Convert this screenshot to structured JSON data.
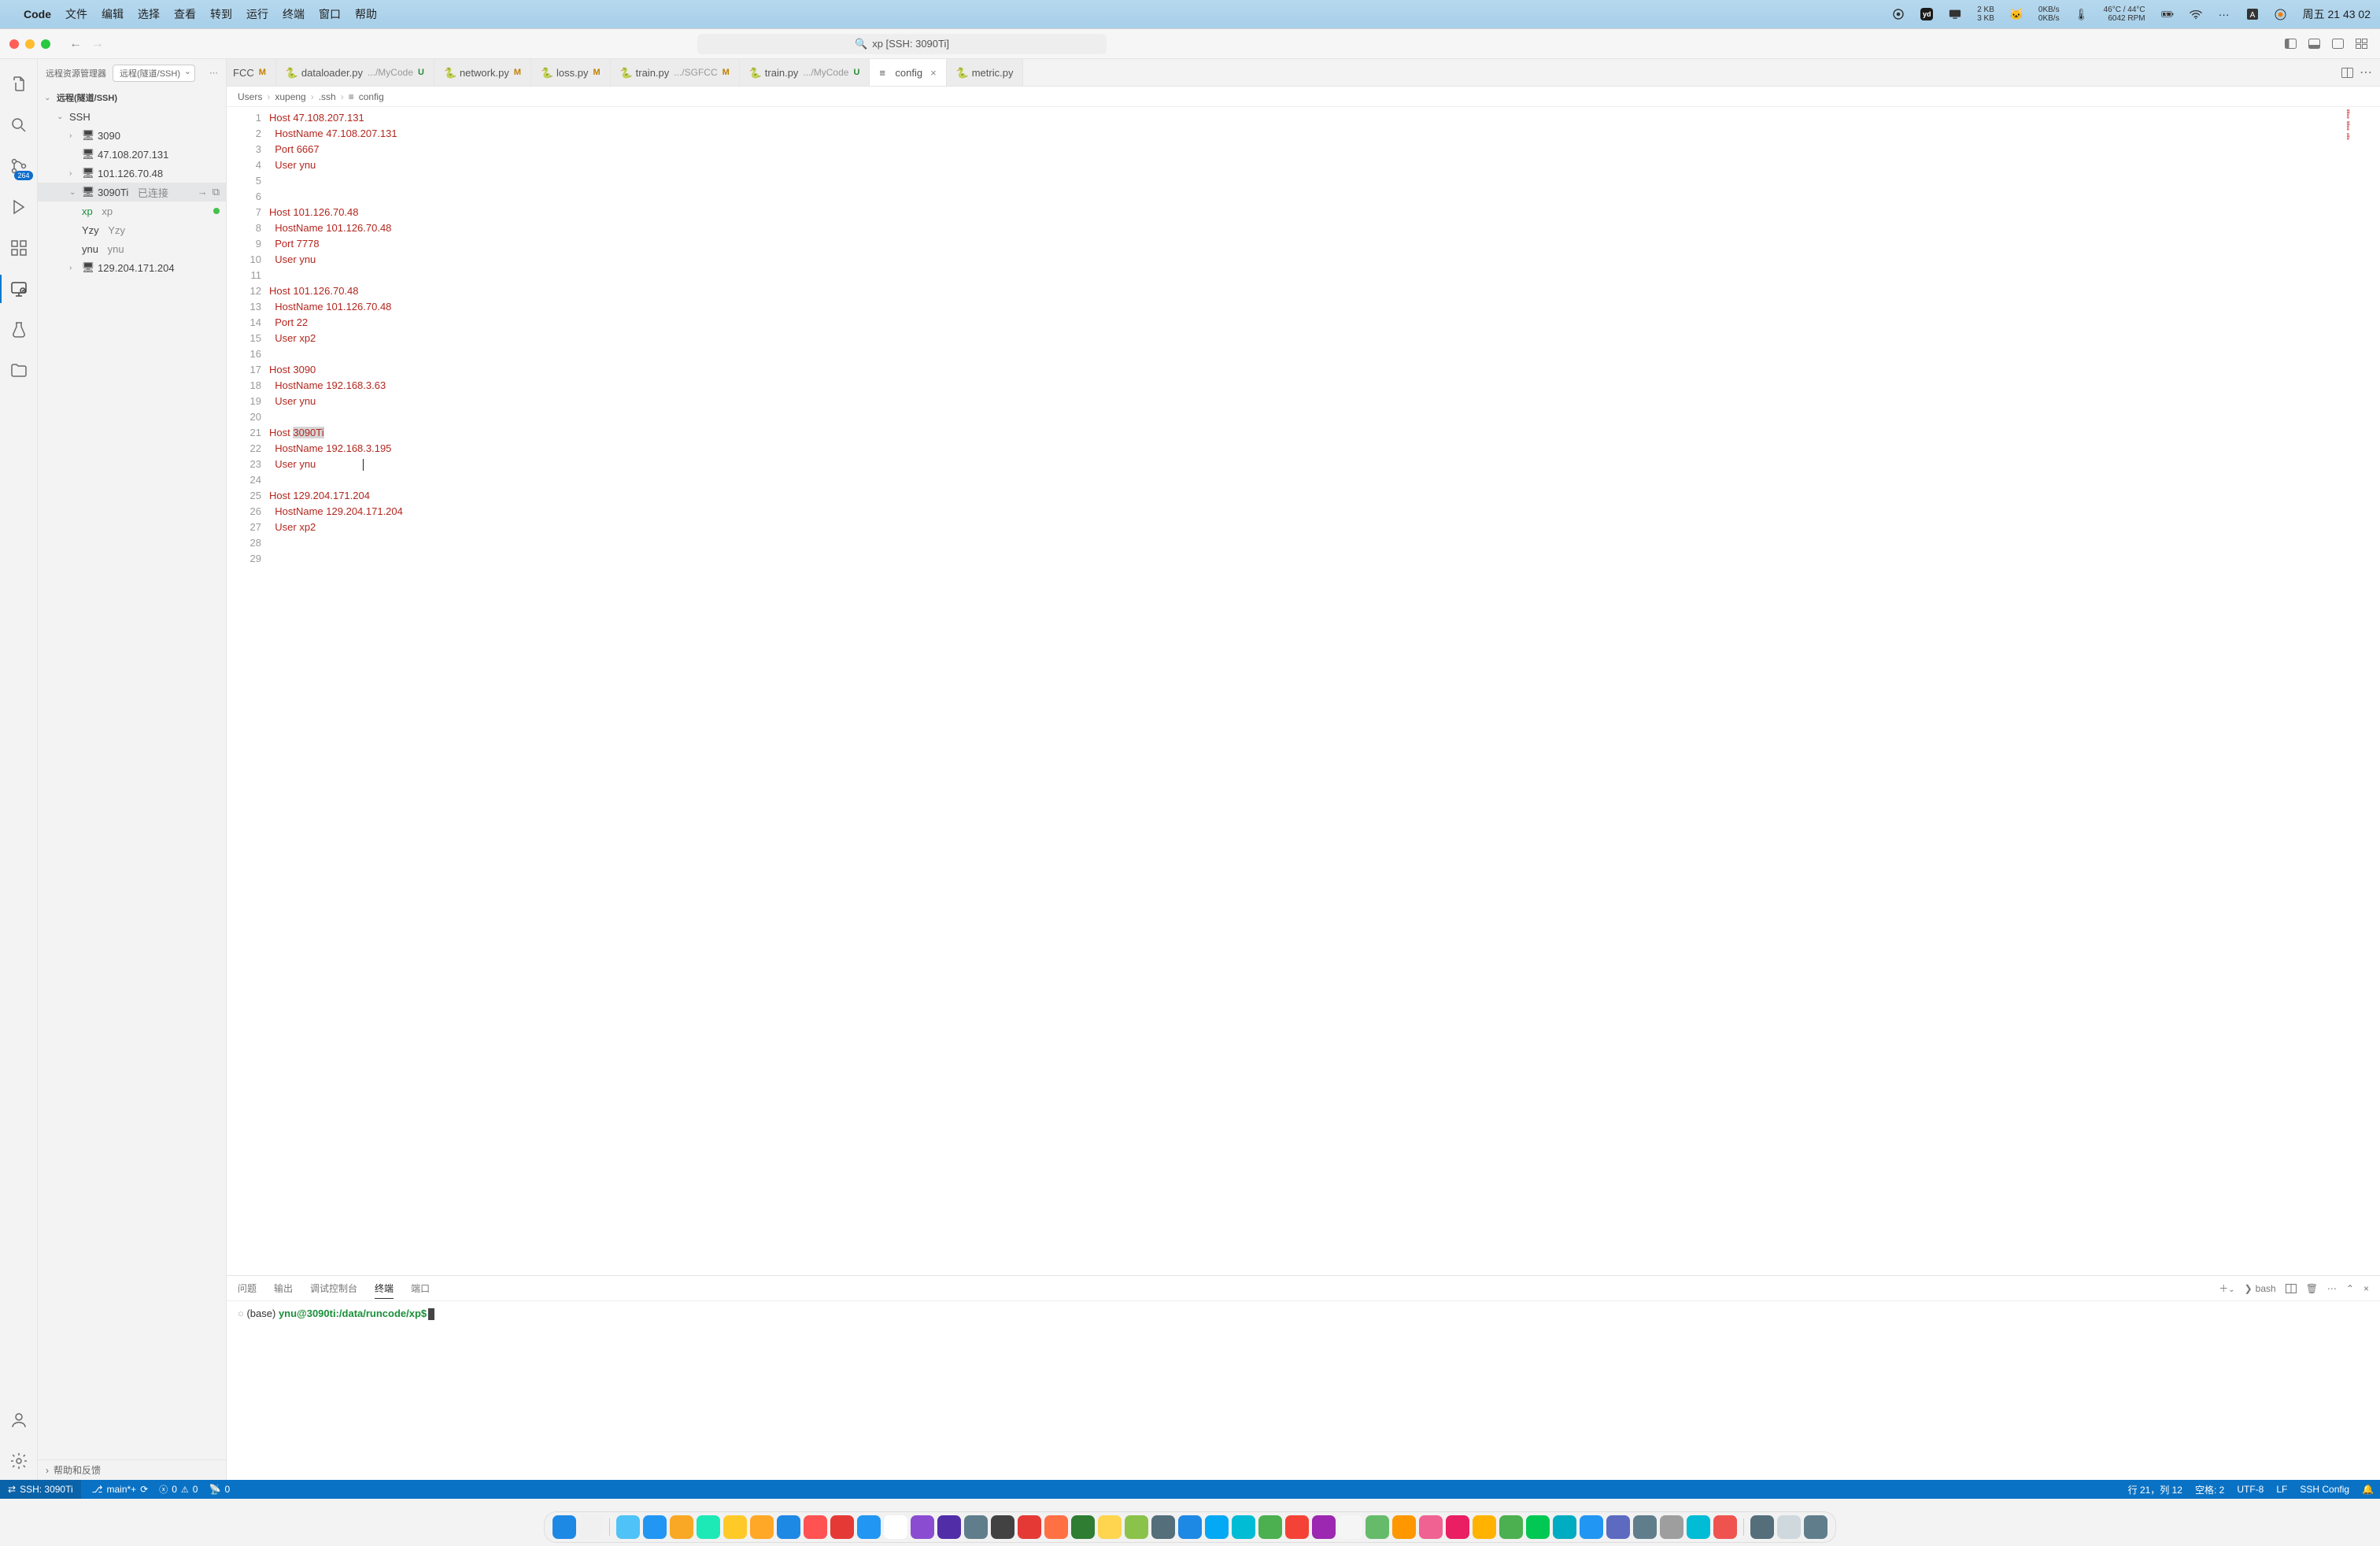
{
  "menubar": {
    "app": "Code",
    "items": [
      "文件",
      "编辑",
      "选择",
      "查看",
      "转到",
      "运行",
      "终端",
      "窗口",
      "帮助"
    ],
    "net1": "2 KB\n3 KB",
    "net2": "0KB/s\n0KB/s",
    "temp": "46°C / 44°C\n6042 RPM",
    "clock": "周五  21 43 02"
  },
  "titlebar": {
    "title": "xp [SSH: 3090Ti]"
  },
  "activityBadge": "264",
  "sidebar": {
    "title": "远程资源管理器",
    "dd": "远程(隧道/SSH)",
    "root": "远程(隧道/SSH)",
    "ssh": "SSH",
    "items": [
      {
        "label": "3090"
      },
      {
        "label": "47.108.207.131"
      },
      {
        "label": "101.126.70.48"
      },
      {
        "label": "3090Ti",
        "suffix": "已连接"
      },
      {
        "label": "xp",
        "sub": "xp"
      },
      {
        "label": "Yzy",
        "sub": "Yzy"
      },
      {
        "label": "ynu",
        "sub": "ynu"
      },
      {
        "label": "129.204.171.204"
      }
    ],
    "footer": "帮助和反馈"
  },
  "tabs": [
    {
      "name": "FCC",
      "mod": "M"
    },
    {
      "name": "dataloader.py",
      "path": ".../MyCode",
      "mod": "U"
    },
    {
      "name": "network.py",
      "mod": "M"
    },
    {
      "name": "loss.py",
      "mod": "M"
    },
    {
      "name": "train.py",
      "path": ".../SGFCC",
      "mod": "M"
    },
    {
      "name": "train.py",
      "path": ".../MyCode",
      "mod": "U"
    },
    {
      "name": "config",
      "active": true
    },
    {
      "name": "metric.py"
    }
  ],
  "crumbs": [
    "Users",
    "xupeng",
    ".ssh",
    "config"
  ],
  "code": [
    {
      "n": 1,
      "t": "Host 47.108.207.131"
    },
    {
      "n": 2,
      "t": "  HostName 47.108.207.131"
    },
    {
      "n": 3,
      "t": "  Port 6667"
    },
    {
      "n": 4,
      "t": "  User ynu"
    },
    {
      "n": 5,
      "t": ""
    },
    {
      "n": 6,
      "t": ""
    },
    {
      "n": 7,
      "t": "Host 101.126.70.48"
    },
    {
      "n": 8,
      "t": "  HostName 101.126.70.48"
    },
    {
      "n": 9,
      "t": "  Port 7778"
    },
    {
      "n": 10,
      "t": "  User ynu"
    },
    {
      "n": 11,
      "t": ""
    },
    {
      "n": 12,
      "t": "Host 101.126.70.48"
    },
    {
      "n": 13,
      "t": "  HostName 101.126.70.48"
    },
    {
      "n": 14,
      "t": "  Port 22"
    },
    {
      "n": 15,
      "t": "  User xp2"
    },
    {
      "n": 16,
      "t": ""
    },
    {
      "n": 17,
      "t": "Host 3090"
    },
    {
      "n": 18,
      "t": "  HostName 192.168.3.63"
    },
    {
      "n": 19,
      "t": "  User ynu"
    },
    {
      "n": 20,
      "t": ""
    },
    {
      "n": 21,
      "t": "Host 3090Ti",
      "hl": true,
      "sel": "3090Ti"
    },
    {
      "n": 22,
      "t": "  HostName 192.168.3.195"
    },
    {
      "n": 23,
      "t": "  User ynu",
      "cursor": true
    },
    {
      "n": 24,
      "t": ""
    },
    {
      "n": 25,
      "t": "Host 129.204.171.204"
    },
    {
      "n": 26,
      "t": "  HostName 129.204.171.204"
    },
    {
      "n": 27,
      "t": "  User xp2"
    },
    {
      "n": 28,
      "t": ""
    },
    {
      "n": 29,
      "t": ""
    }
  ],
  "panel": {
    "tabs": [
      "问题",
      "输出",
      "调试控制台",
      "终端",
      "端口"
    ],
    "activeTab": "终端",
    "shell": "bash",
    "termBase": "(base) ",
    "termPrompt": "ynu@3090ti:/data/runcode/xp$"
  },
  "status": {
    "remote": "SSH: 3090Ti",
    "branch": "main*+",
    "errors": "0",
    "warnings": "0",
    "ports": "0",
    "cursor": "行 21，列 12",
    "spaces": "空格: 2",
    "enc": "UTF-8",
    "eol": "LF",
    "lang": "SSH Config"
  },
  "dockColors": [
    "#1e88e5",
    "#f0f0f0",
    "#4fc3f7",
    "#2196f3",
    "#f9a825",
    "#1de9b6",
    "#ffca28",
    "#ffa726",
    "#1e88e5",
    "#ff5252",
    "#e53935",
    "#2196f3",
    "#ffffff",
    "#8a4dd1",
    "#512da8",
    "#607d8b",
    "#424242",
    "#e53935",
    "#ff7043",
    "#2e7d32",
    "#ffd54f",
    "#8bc34a",
    "#546e7a",
    "#1e88e5",
    "#03a9f4",
    "#00bcd4",
    "#4caf50",
    "#f44336",
    "#9c27b0",
    "#f5f5f5",
    "#66bb6a",
    "#ff9800",
    "#f06292",
    "#e91e63",
    "#ffb300",
    "#4caf50",
    "#00c853",
    "#00acc1",
    "#2196f3",
    "#5c6bc0",
    "#607d8b",
    "#9e9e9e",
    "#00bcd4",
    "#ef5350",
    "#546e7a",
    "#cfd8dc",
    "#607d8b"
  ]
}
